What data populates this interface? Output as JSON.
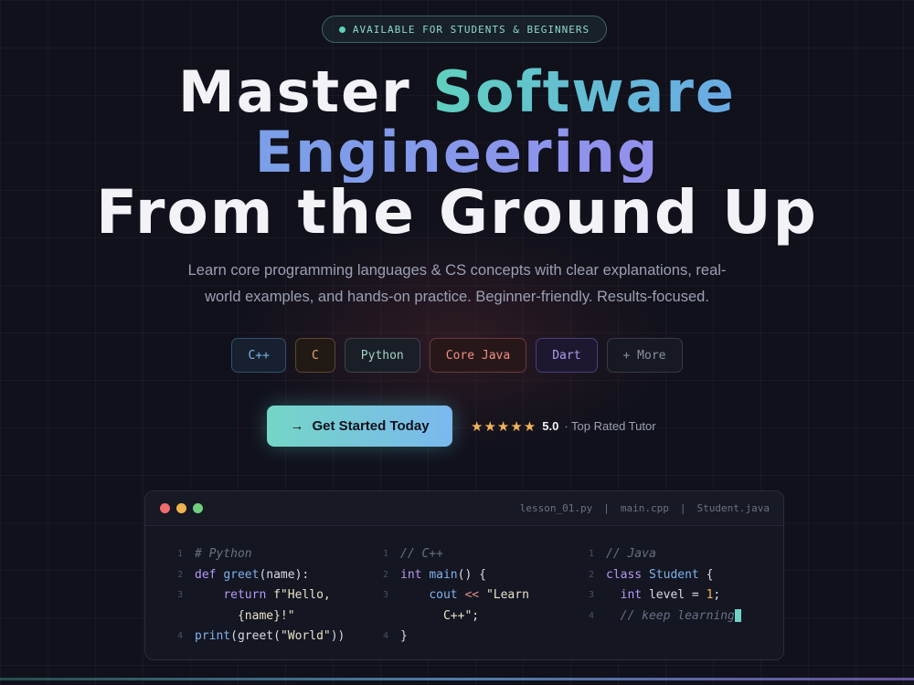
{
  "badge": {
    "text": "AVAILABLE FOR STUDENTS & BEGINNERS"
  },
  "hero": {
    "line1_plain": "Master ",
    "line1_accent": "Software",
    "line2_accent": "Engineering",
    "line3": "From the Ground Up"
  },
  "subtitle": {
    "line1": "Learn core programming languages & CS concepts with clear explanations, real-",
    "line2": "world examples, and hands-on practice. Beginner-friendly. Results-focused."
  },
  "tags": [
    {
      "label": "C++"
    },
    {
      "label": "C"
    },
    {
      "label": "Python"
    },
    {
      "label": "Core Java"
    },
    {
      "label": "Dart"
    },
    {
      "label": "+ More"
    }
  ],
  "cta": {
    "icon": "arrow-right-icon",
    "arrow": "→",
    "label": "Get Started Today"
  },
  "rating": {
    "stars": "★★★★★",
    "star_count": 5,
    "score": "5.0",
    "text": "· Top Rated Tutor"
  },
  "editor": {
    "files": [
      "lesson_01.py",
      "|",
      "main.cpp",
      "|",
      "Student.java"
    ],
    "python": {
      "nums": [
        "1",
        "2",
        "3",
        "4"
      ],
      "comment": "# Python",
      "def_kw": "def",
      "def_fn": "greet",
      "def_rest": "(name):",
      "ret_kw": "return",
      "ret_str": "f\"Hello,",
      "ret_str2": "{name}!\"",
      "print_fn": "print",
      "print_rest1": "(",
      "print_fn2": "greet",
      "print_rest2": "(",
      "print_str": "\"World\"",
      "print_rest3": "))"
    },
    "cpp": {
      "nums": [
        "1",
        "2",
        "3",
        "4"
      ],
      "comment": "// C++",
      "int_kw": "int",
      "main_fn": "main",
      "main_rest": "() {",
      "cout": "cout",
      "op": "<<",
      "str": "\"Learn",
      "str2": "C++\";",
      "close": "}"
    },
    "java": {
      "nums": [
        "1",
        "2",
        "3",
        "4"
      ],
      "comment": "// Java",
      "class_kw": "class",
      "class_name": "Student",
      "class_rest": " {",
      "int_kw": "int",
      "field": " level = ",
      "val": "1",
      "semi": ";",
      "comment2": "// keep learning"
    }
  },
  "colors": {
    "background": "#10111b",
    "accent_teal": "#5fd1bf",
    "accent_blue": "#6aa9e6",
    "accent_purple": "#a487ef",
    "star": "#f0b35a"
  }
}
